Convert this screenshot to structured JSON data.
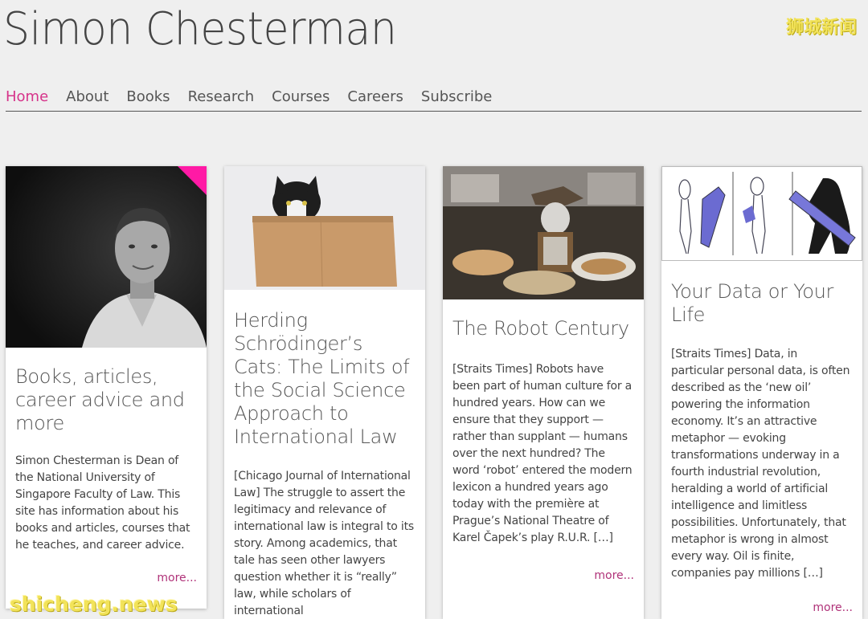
{
  "site": {
    "title": "Simon Chesterman"
  },
  "watermarks": {
    "cn": "狮城新闻",
    "en": "shicheng.news"
  },
  "nav": {
    "items": [
      "Home",
      "About",
      "Books",
      "Research",
      "Courses",
      "Careers",
      "Subscribe"
    ],
    "active": "Home"
  },
  "colors": {
    "accent": "#d6338a",
    "corner": "#ff1aa5"
  },
  "cards": [
    {
      "image": "portrait-photo",
      "title": "Books, articles, career advice and more",
      "text": "Simon Chesterman is Dean of the National University of Singapore Faculty of Law. This site has information about his books and articles, courses that he teaches, and career advice.",
      "more": "more..."
    },
    {
      "image": "cat-in-box-photo",
      "title": "Herding Schrödinger’s Cats: The Limits of the Social Science Approach to International Law",
      "text": "[Chicago Journal of International Law] The struggle to assert the legitimacy and relevance of international law is integral to its story. Among academics, that tale has seen other lawyers question whether it is “really” law, while scholars of international",
      "more": ""
    },
    {
      "image": "robot-photo",
      "title": "The Robot Century",
      "text": "[Straits Times] Robots have been part of human culture for a hundred years. How can we ensure that they support — rather than supplant — humans over the next hundred?   The word ‘robot’ entered the modern lexicon a hundred years ago today with the première at Prague’s National Theatre of Karel Čapek’s play R.U.R. […]",
      "more": "more..."
    },
    {
      "image": "data-illustration",
      "title": "Your Data or Your Life",
      "text": "[Straits Times] Data, in particular personal data, is often described as the ‘new oil’ powering the information economy. It’s an attractive metaphor — evoking transformations underway in a fourth industrial revolution, heralding a world of artificial intelligence and limitless possibilities. Unfortunately, that metaphor is wrong in almost every way. Oil is finite, companies pay millions […]",
      "more": "more..."
    }
  ]
}
